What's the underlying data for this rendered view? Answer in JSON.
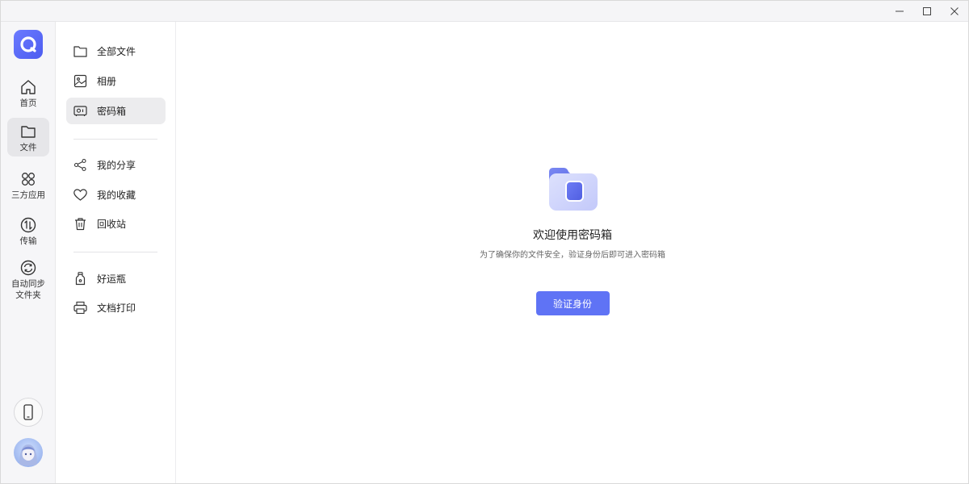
{
  "window_controls": {
    "minimize_icon": "minimize-icon",
    "maximize_icon": "maximize-icon",
    "close_icon": "close-icon"
  },
  "rail": {
    "items": [
      {
        "label": "首页",
        "icon": "home-icon"
      },
      {
        "label": "文件",
        "icon": "folder-icon",
        "active": true
      },
      {
        "label": "三方应用",
        "icon": "apps-grid-icon"
      },
      {
        "label": "传输",
        "icon": "transfer-icon"
      },
      {
        "label": "自动同步\n文件夹",
        "icon": "sync-icon"
      }
    ]
  },
  "subnav": {
    "items": [
      {
        "label": "全部文件",
        "icon": "folder-icon"
      },
      {
        "label": "相册",
        "icon": "photo-icon"
      },
      {
        "label": "密码箱",
        "icon": "safe-icon",
        "active": true
      },
      {
        "label": "我的分享",
        "icon": "share-icon"
      },
      {
        "label": "我的收藏",
        "icon": "heart-icon"
      },
      {
        "label": "回收站",
        "icon": "trash-icon"
      },
      {
        "label": "好运瓶",
        "icon": "bottle-icon"
      },
      {
        "label": "文档打印",
        "icon": "printer-icon"
      }
    ]
  },
  "main": {
    "title": "欢迎使用密码箱",
    "description": "为了确保你的文件安全，验证身份后即可进入密码箱",
    "verify_button": "验证身份"
  },
  "colors": {
    "accent": "#5f73f5",
    "active_bg": "#ececee"
  }
}
